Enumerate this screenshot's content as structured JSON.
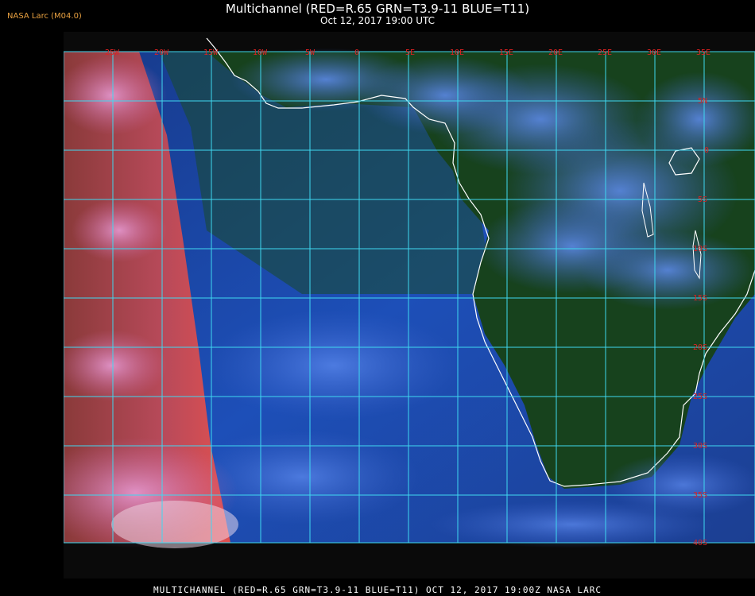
{
  "header": {
    "brand": "NASA Larc (M04.0)",
    "title": "Multichannel (RED=R.65 GRN=T3.9-11 BLUE=T11)",
    "datetime": "Oct 12, 2017 19:00 UTC"
  },
  "footer": {
    "caption": "MULTICHANNEL (RED=R.65 GRN=T3.9-11 BLUE=T11) OCT 12, 2017 19:00Z   NASA LARC"
  },
  "map": {
    "lon_labels": [
      "25W",
      "20W",
      "15W",
      "10W",
      "5W",
      "0",
      "5E",
      "10E",
      "15E",
      "20E",
      "25E",
      "30E",
      "35E"
    ],
    "lat_labels": [
      "5N",
      "0",
      "5S",
      "10S",
      "15S",
      "20S",
      "25S",
      "30S",
      "35S",
      "40S"
    ],
    "colors": {
      "grid": "#3fd8f0",
      "tick_label": "#d22222",
      "coastline": "#ffffff",
      "ocean": "#1a3fa0",
      "land": "#1a4a1e",
      "clouds": "#4a7ae6",
      "red_channel": "#e0588a"
    }
  }
}
